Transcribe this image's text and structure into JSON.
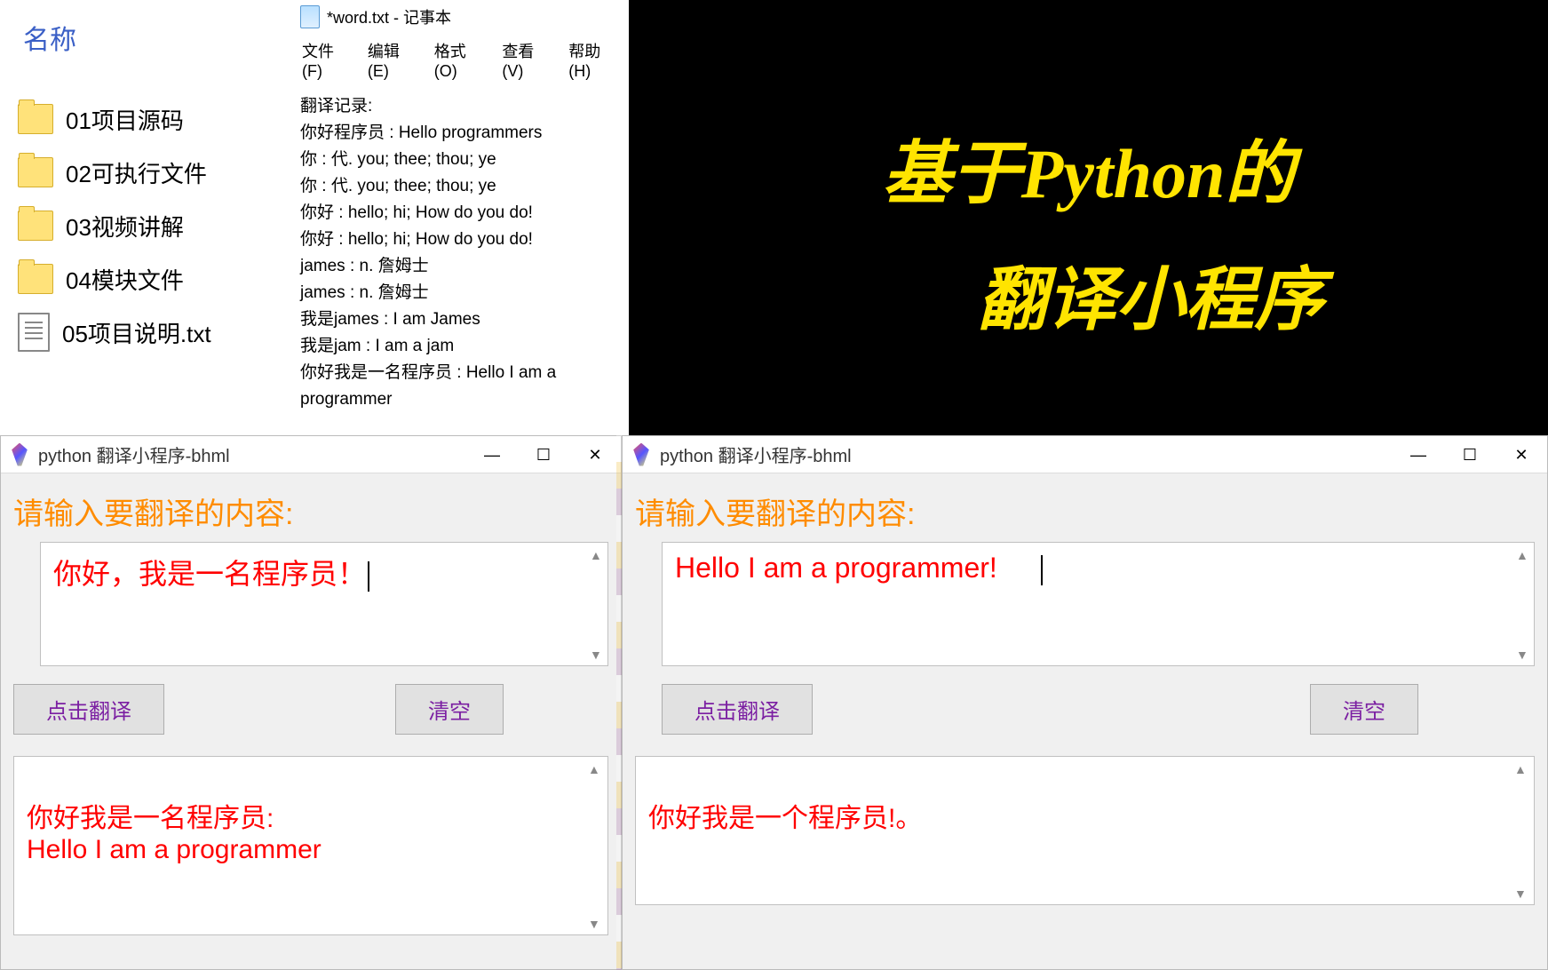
{
  "explorer": {
    "header": "名称",
    "items": [
      {
        "type": "folder",
        "name": "01项目源码"
      },
      {
        "type": "folder",
        "name": "02可执行文件"
      },
      {
        "type": "folder",
        "name": "03视频讲解"
      },
      {
        "type": "folder",
        "name": "04模块文件"
      },
      {
        "type": "txt",
        "name": "05项目说明.txt"
      }
    ]
  },
  "notepad": {
    "title": "*word.txt - 记事本",
    "menu": {
      "file": "文件(F)",
      "edit": "编辑(E)",
      "format": "格式(O)",
      "view": "查看(V)",
      "help": "帮助(H)"
    },
    "lines": [
      "翻译记录:",
      "你好程序员 : Hello programmers",
      "你 : 代. you; thee; thou; ye",
      "你 : 代. you; thee; thou; ye",
      "你好 : hello; hi; How do you do!",
      "你好 : hello; hi; How do you do!",
      "james : n. 詹姆士",
      "james : n. 詹姆士",
      "我是james : I am James",
      "我是jam : I am a jam",
      "你好我是一名程序员 : Hello I am a programmer"
    ]
  },
  "banner": {
    "line1": "基于Python的",
    "line2": "翻译小程序"
  },
  "tk": {
    "title": "python 翻译小程序-bhml",
    "prompt": "请输入要翻译的内容:",
    "translate_btn": "点击翻译",
    "clear_btn": "清空",
    "win_controls": {
      "min": "—",
      "max": "☐",
      "close": "✕"
    }
  },
  "left_app": {
    "input": "你好，我是一名程序员！",
    "output": "你好我是一名程序员:\nHello I am a programmer"
  },
  "right_app": {
    "input": "Hello I am a programmer!",
    "output": "你好我是一个程序员!。"
  }
}
